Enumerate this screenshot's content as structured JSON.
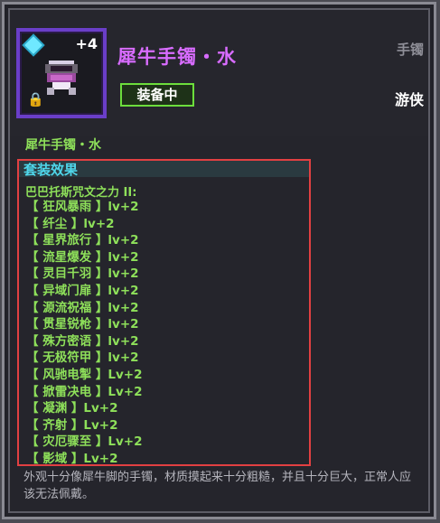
{
  "item": {
    "name": "犀牛手镯・水",
    "plus": "+4",
    "type": "手镯",
    "equipped_label": "装备中",
    "class": "游侠",
    "subname": "犀牛手镯・水"
  },
  "set": {
    "title": "套装效果",
    "subtitle": "巴巴托斯咒文之力 II:",
    "skills": [
      "【 狂风暴雨 】lv+2",
      "【 纤尘 】lv+2",
      "【 星界旅行 】lv+2",
      "【 流星爆发 】lv+2",
      "【 灵目千羽 】lv+2",
      "【 异域门扉 】lv+2",
      "【 源流祝福 】lv+2",
      "【 贯星锐枪 】lv+2",
      "【 殊方密语 】lv+2",
      "【 无极符甲 】lv+2",
      "【 风驰电掣 】Lv+2",
      "【 掀雷决电 】Lv+2",
      "【 凝渊 】Lv+2",
      "【 齐射 】Lv+2",
      "【 灾厄骤至 】Lv+2",
      "【 影域 】Lv+2"
    ]
  },
  "description": "外观十分像犀牛脚的手镯，材质摸起来十分粗糙，并且十分巨大，正常人应该无法佩戴。",
  "colors": {
    "title": "#d86cff",
    "green": "#8ee05a",
    "cyan": "#4fd6ea",
    "rarity_border": "#6a3ec8",
    "highlight_box": "#e24042"
  },
  "icons": [
    "diamond-gem-icon",
    "bracelet-item-icon",
    "lock-icon"
  ]
}
